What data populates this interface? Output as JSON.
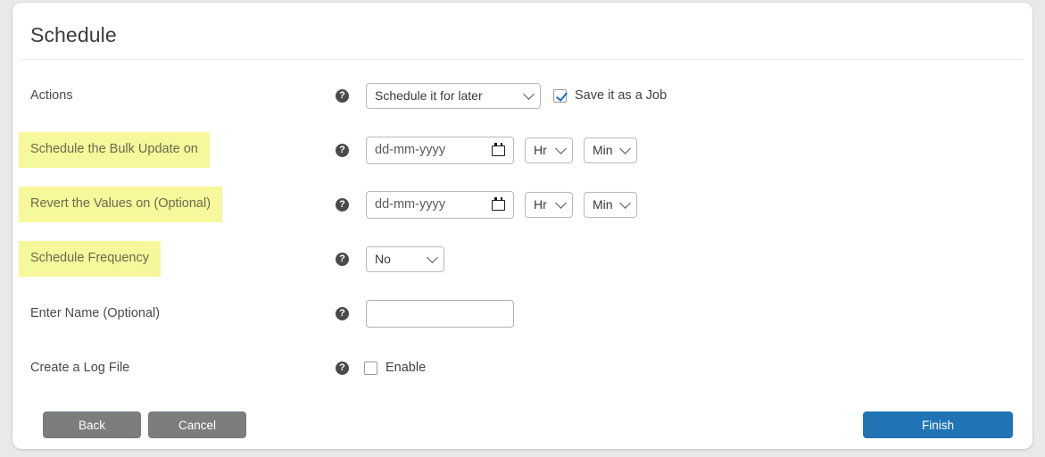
{
  "window": {
    "title": "Schedule"
  },
  "theme": {
    "page_background": "#e9e9e9",
    "card_background": "#ffffff",
    "highlight_background": "#f7f79b",
    "highlight_text": "#6b6b4f",
    "primary_button": "#2074b6",
    "secondary_button": "#7d7d7d",
    "checkbox_accent": "#1c6fc4"
  },
  "help_icon_glyph": "?",
  "rows": [
    {
      "label": "Actions",
      "highlighted": false,
      "help_icon": "help-circle-icon",
      "select_value": "Schedule it for later",
      "checkbox_label": "Save it as a Job",
      "checkbox_checked": true
    },
    {
      "label": "Schedule the Bulk Update on",
      "highlighted": true,
      "help_icon": "help-circle-icon",
      "date_placeholder": "dd-mm-yyyy",
      "date_value": "",
      "hour_value": "Hr",
      "minute_value": "Min"
    },
    {
      "label": "Revert the Values on (Optional)",
      "highlighted": true,
      "help_icon": "help-circle-icon",
      "date_placeholder": "dd-mm-yyyy",
      "date_value": "",
      "hour_value": "Hr",
      "minute_value": "Min"
    },
    {
      "label": "Schedule Frequency",
      "highlighted": true,
      "help_icon": "help-circle-icon",
      "select_value": "No"
    },
    {
      "label": "Enter Name (Optional)",
      "highlighted": false,
      "help_icon": "help-circle-icon",
      "text_value": "",
      "text_placeholder": ""
    },
    {
      "label": "Create a Log File",
      "highlighted": false,
      "help_icon": "help-circle-icon",
      "checkbox_label": "Enable",
      "checkbox_checked": false
    }
  ],
  "footer": {
    "back_label": "Back",
    "cancel_label": "Cancel",
    "finish_label": "Finish"
  }
}
